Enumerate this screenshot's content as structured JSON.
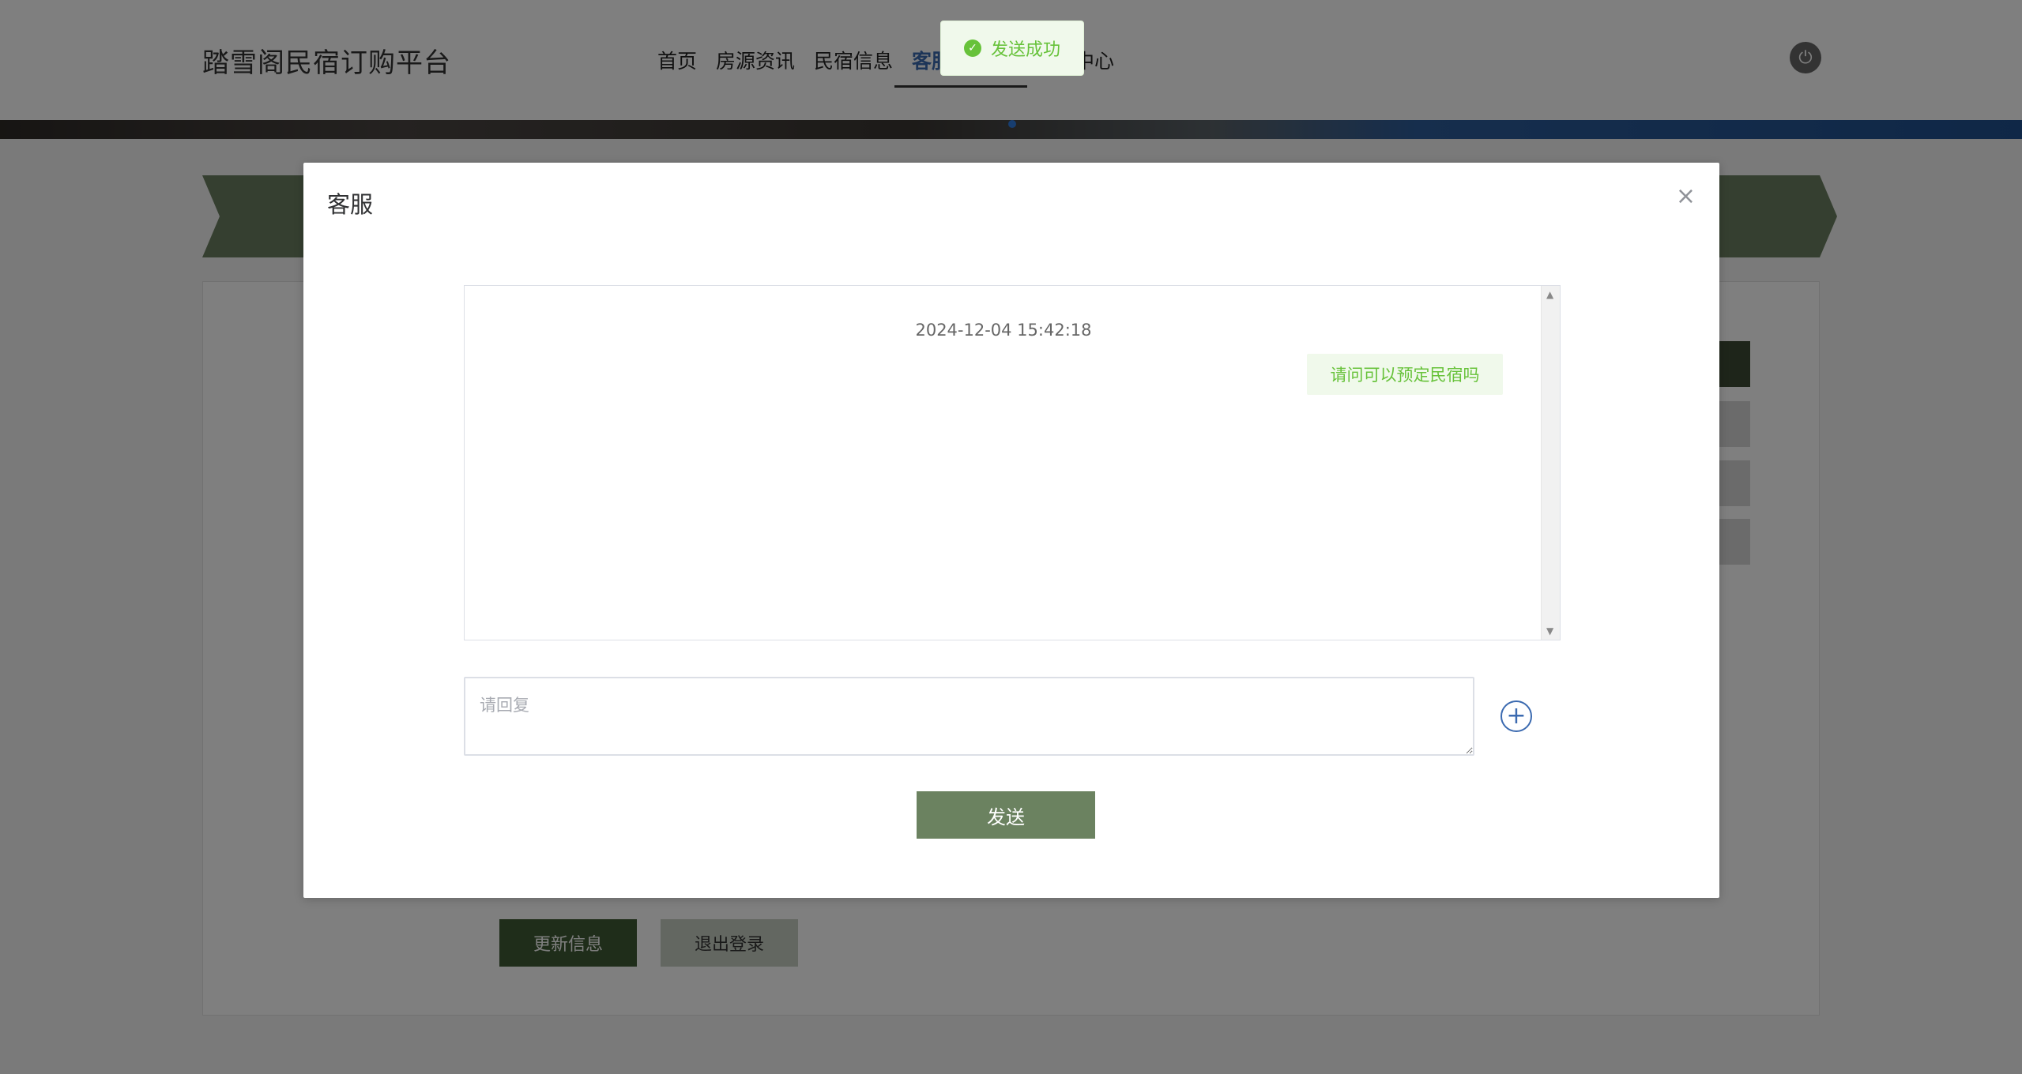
{
  "header": {
    "brand": "踏雪阁民宿订购平台",
    "nav": [
      {
        "label": "首页"
      },
      {
        "label": "房源资讯"
      },
      {
        "label": "民宿信息"
      },
      {
        "label": "客服"
      }
    ],
    "nav_tail": "中心"
  },
  "page": {
    "update_button": "更新信息",
    "logout_button": "退出登录"
  },
  "dialog": {
    "title": "客服",
    "close_symbol": "×",
    "chat": {
      "timestamp": "2024-12-04 15:42:18",
      "message": "请问可以预定民宿吗"
    },
    "reply_placeholder": "请回复",
    "send_button": "发送"
  },
  "toast": {
    "message": "发送成功"
  },
  "colors": {
    "accent": "#6b8260",
    "success": "#67c23a",
    "link": "#3b6ab0"
  }
}
